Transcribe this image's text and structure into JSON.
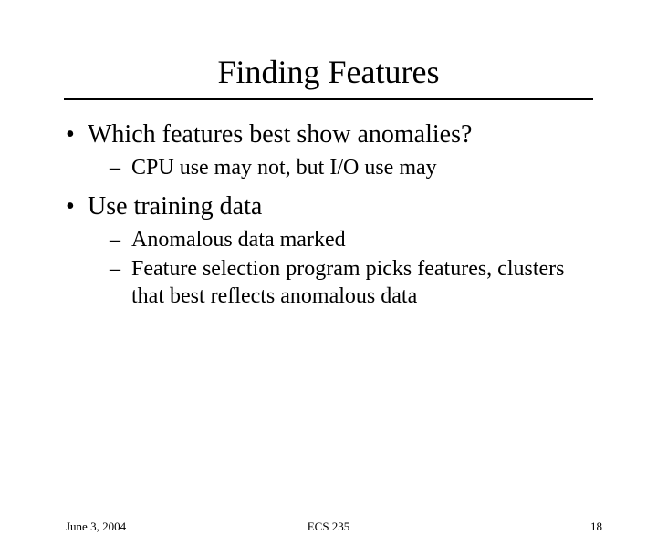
{
  "title": "Finding Features",
  "bullets": [
    {
      "text": "Which features best show anomalies?",
      "sub": [
        "CPU use may not, but I/O use may"
      ]
    },
    {
      "text": "Use training data",
      "sub": [
        "Anomalous data marked",
        "Feature selection program picks features, clusters that best reflects anomalous data"
      ]
    }
  ],
  "footer": {
    "date": "June 3, 2004",
    "course": "ECS 235",
    "page": "18"
  }
}
